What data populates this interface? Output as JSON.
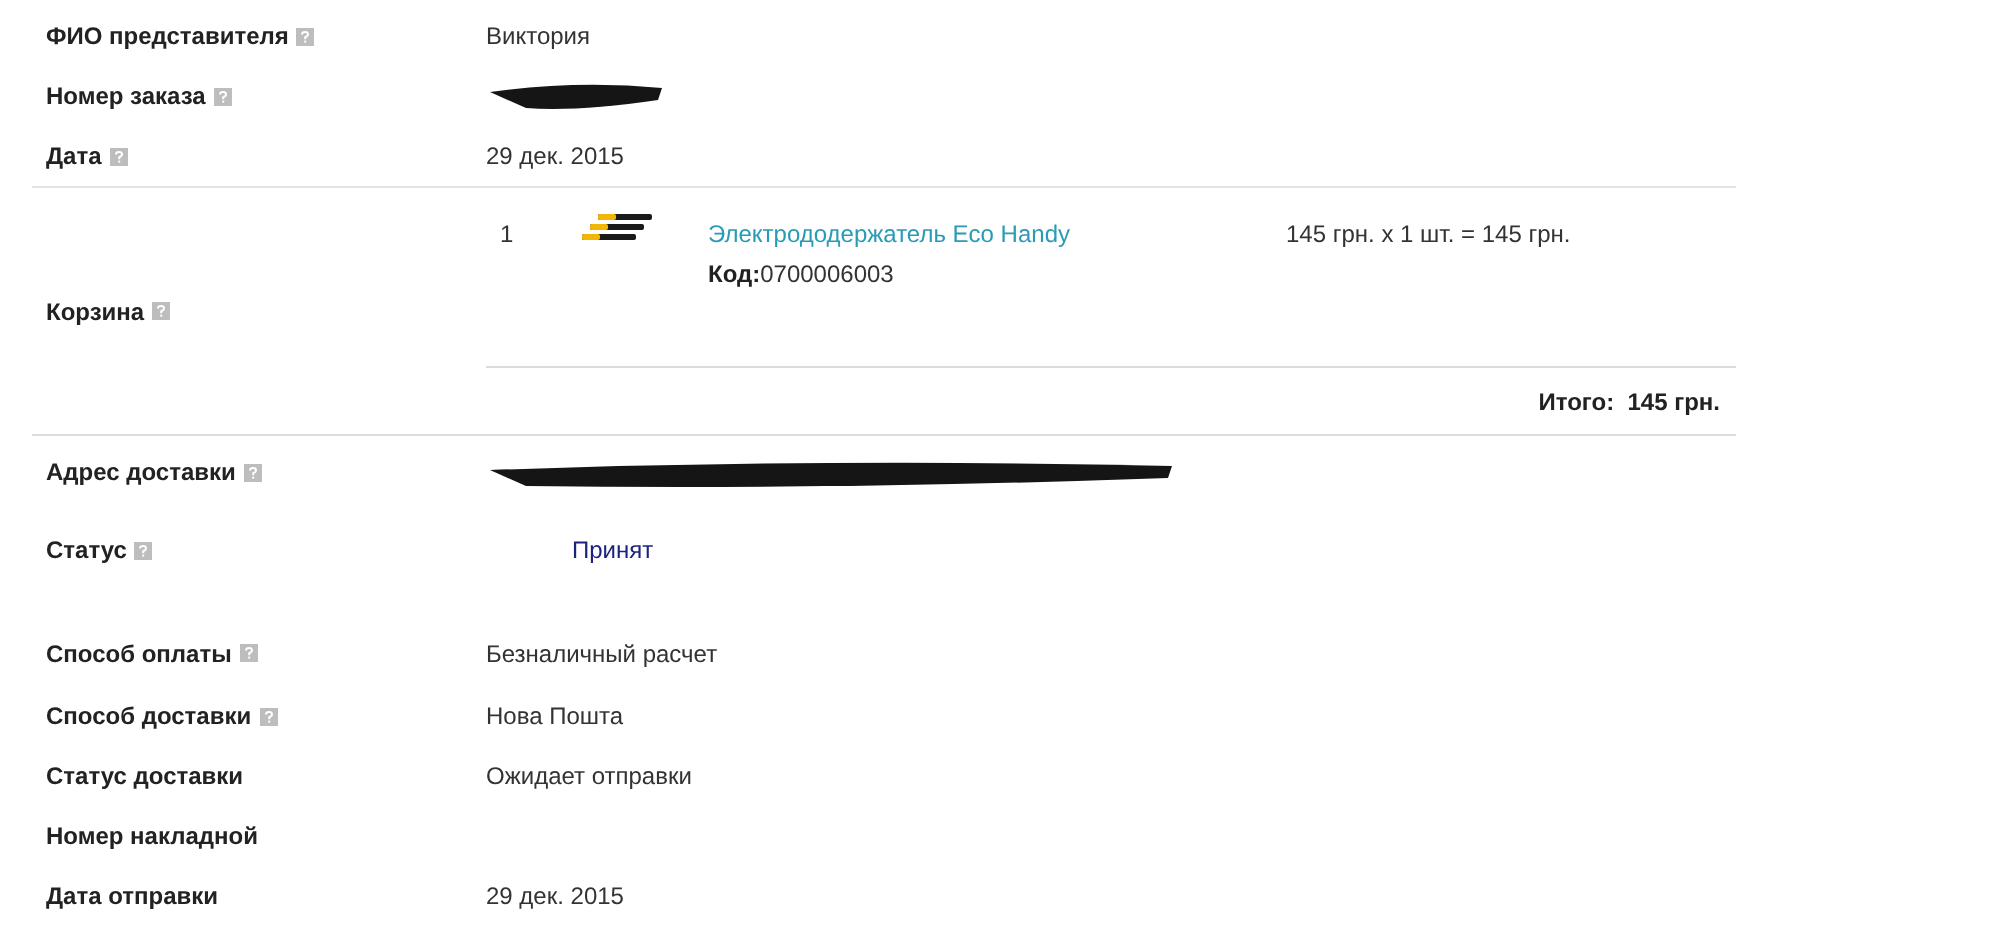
{
  "fields_top": [
    {
      "label": "ФИО представителя",
      "help": true,
      "value": "Виктория"
    },
    {
      "label": "Номер заказа",
      "help": true,
      "redacted": true
    },
    {
      "label": "Дата",
      "help": true,
      "value": "29 дек. 2015"
    }
  ],
  "cart": {
    "label": "Корзина",
    "help": true,
    "items": [
      {
        "number": "1",
        "name": "Электрододержатель Eco Handy",
        "code_label": "Код:",
        "code": "0700006003",
        "price": "145 грн. x 1 шт. = 145 грн."
      }
    ],
    "total_label": "Итого:",
    "total": "145 грн."
  },
  "fields_bottom": [
    {
      "label": "Адрес доставки",
      "help": true,
      "redacted": true
    },
    {
      "label": "Статус",
      "help": true,
      "value": "Принят",
      "kind": "status"
    },
    {
      "label": "Способ оплаты",
      "help": true,
      "value": "Безналичный расчет"
    },
    {
      "label": "Способ доставки",
      "help": true,
      "value": "Нова Пошта"
    },
    {
      "label": "Статус доставки",
      "help": false,
      "value": "Ожидает отправки"
    },
    {
      "label": "Номер накладной",
      "help": false
    },
    {
      "label": "Дата отправки",
      "help": false,
      "value": "29 дек. 2015"
    }
  ]
}
